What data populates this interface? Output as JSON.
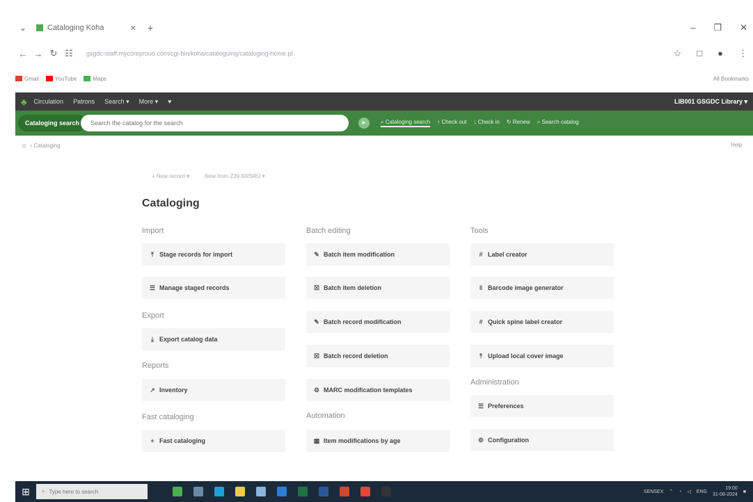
{
  "browser": {
    "tab_title": "Cataloging Koha",
    "url": "gsgdc-staff.mycoreproud.com/cgi-bin/koha/cataloguing/cataloging-home.pl",
    "bookmarks": [
      {
        "label": "Gmail",
        "color": "#d44638"
      },
      {
        "label": "YouTube",
        "color": "#ff0000"
      },
      {
        "label": "Maps",
        "color": "#4caf50"
      }
    ],
    "all_bookmarks": "All Bookmarks"
  },
  "koha_nav": {
    "items": [
      "Circulation",
      "Patrons",
      "Search ▾",
      "More ▾"
    ],
    "user_library": "LIB001  GSGDC Library ▾"
  },
  "search_header": {
    "search_type": "Cataloging search",
    "placeholder": "Search the catalog for the search",
    "tabs": [
      "Cataloging search",
      "Check out",
      "Check in",
      "Renew",
      "Search catalog"
    ]
  },
  "breadcrumb": {
    "current": "Cataloging",
    "help": "Help"
  },
  "toolbar": {
    "new_record": "+ New record ▾",
    "new_from_z3950": "New from Z39.50/SRU ▾"
  },
  "page_title": "Cataloging",
  "sections": {
    "import": {
      "title": "Import",
      "items": [
        "Stage records for import",
        "Manage staged records"
      ]
    },
    "export": {
      "title": "Export",
      "items": [
        "Export catalog data"
      ]
    },
    "reports": {
      "title": "Reports",
      "items": [
        "Inventory"
      ]
    },
    "fast_cataloging": {
      "title": "Fast cataloging",
      "items": [
        "Fast cataloging"
      ]
    },
    "batch_editing": {
      "title": "Batch editing",
      "items": [
        "Batch item modification",
        "Batch item deletion",
        "Batch record modification",
        "Batch record deletion",
        "MARC modification templates"
      ]
    },
    "automation": {
      "title": "Automation",
      "items": [
        "Item modifications by age"
      ]
    },
    "tools": {
      "title": "Tools",
      "items": [
        "Label creator",
        "Barcode image generator",
        "Quick spine label creator",
        "Upload local cover image"
      ]
    },
    "administration": {
      "title": "Administration",
      "items": [
        "Preferences",
        "Configuration"
      ]
    }
  },
  "taskbar": {
    "search_placeholder": "Type here to search",
    "weather": "SENSEX",
    "time": "19:00",
    "date": "31-08-2024",
    "lang": "ENG"
  }
}
